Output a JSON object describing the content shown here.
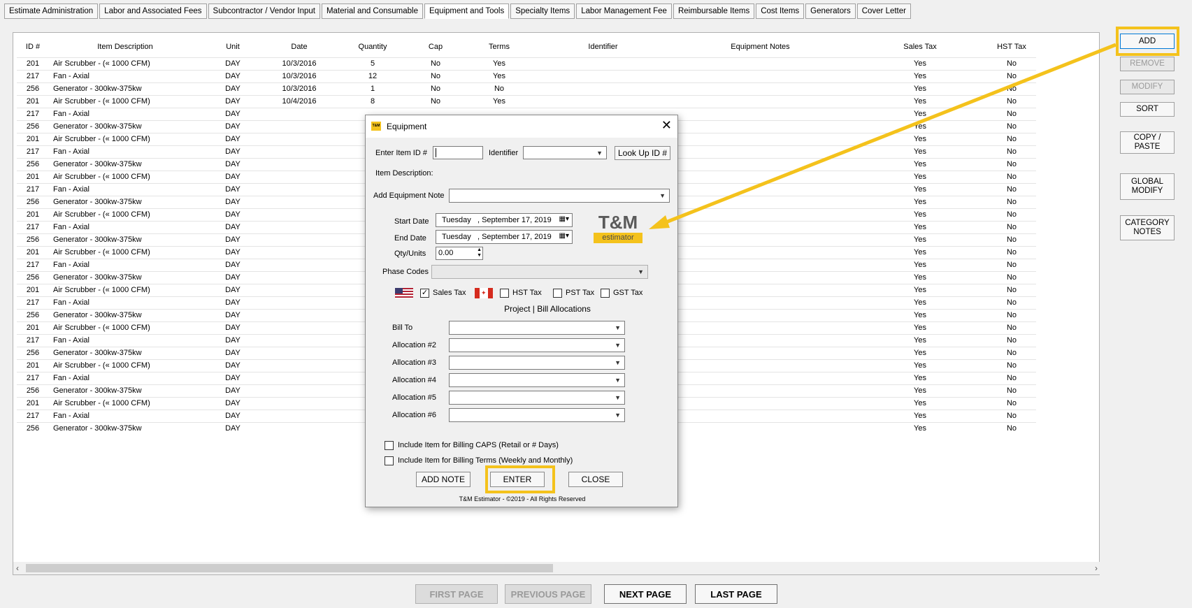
{
  "tabs": [
    "Estimate Administration",
    "Labor and Associated Fees",
    "Subcontractor / Vendor Input",
    "Material and Consumable",
    "Equipment and Tools",
    "Specialty Items",
    "Labor Management Fee",
    "Reimbursable Items",
    "Cost Items",
    "Generators",
    "Cover Letter"
  ],
  "active_tab": "Equipment and Tools",
  "table": {
    "headers": [
      "ID #",
      "Item Description",
      "Unit",
      "Date",
      "Quantity",
      "Cap",
      "Terms",
      "Identifier",
      "Equipment Notes",
      "Sales Tax",
      "HST Tax"
    ],
    "rows": [
      [
        "201",
        "Air Scrubber - (« 1000 CFM)",
        "DAY",
        "10/3/2016",
        "5",
        "No",
        "Yes",
        "",
        "",
        "Yes",
        "No"
      ],
      [
        "217",
        "Fan - Axial",
        "DAY",
        "10/3/2016",
        "12",
        "No",
        "Yes",
        "",
        "",
        "Yes",
        "No"
      ],
      [
        "256",
        "Generator - 300kw-375kw",
        "DAY",
        "10/3/2016",
        "1",
        "No",
        "No",
        "",
        "",
        "Yes",
        "No"
      ],
      [
        "201",
        "Air Scrubber - (« 1000 CFM)",
        "DAY",
        "10/4/2016",
        "8",
        "No",
        "Yes",
        "",
        "",
        "Yes",
        "No"
      ],
      [
        "217",
        "Fan - Axial",
        "DAY",
        "",
        "",
        "",
        "",
        "",
        "",
        "Yes",
        "No"
      ],
      [
        "256",
        "Generator - 300kw-375kw",
        "DAY",
        "",
        "",
        "",
        "",
        "",
        "",
        "Yes",
        "No"
      ],
      [
        "201",
        "Air Scrubber - (« 1000 CFM)",
        "DAY",
        "",
        "",
        "",
        "",
        "",
        "",
        "Yes",
        "No"
      ],
      [
        "217",
        "Fan - Axial",
        "DAY",
        "",
        "",
        "",
        "",
        "",
        "",
        "Yes",
        "No"
      ],
      [
        "256",
        "Generator - 300kw-375kw",
        "DAY",
        "",
        "",
        "",
        "",
        "",
        "",
        "Yes",
        "No"
      ],
      [
        "201",
        "Air Scrubber - (« 1000 CFM)",
        "DAY",
        "",
        "",
        "",
        "",
        "",
        "",
        "Yes",
        "No"
      ],
      [
        "217",
        "Fan - Axial",
        "DAY",
        "",
        "",
        "",
        "",
        "",
        "",
        "Yes",
        "No"
      ],
      [
        "256",
        "Generator - 300kw-375kw",
        "DAY",
        "",
        "",
        "",
        "",
        "",
        "",
        "Yes",
        "No"
      ],
      [
        "201",
        "Air Scrubber - (« 1000 CFM)",
        "DAY",
        "",
        "",
        "",
        "",
        "",
        "",
        "Yes",
        "No"
      ],
      [
        "217",
        "Fan - Axial",
        "DAY",
        "",
        "",
        "",
        "",
        "",
        "",
        "Yes",
        "No"
      ],
      [
        "256",
        "Generator - 300kw-375kw",
        "DAY",
        "",
        "",
        "",
        "",
        "",
        "",
        "Yes",
        "No"
      ],
      [
        "201",
        "Air Scrubber - (« 1000 CFM)",
        "DAY",
        "",
        "",
        "",
        "",
        "",
        "",
        "Yes",
        "No"
      ],
      [
        "217",
        "Fan - Axial",
        "DAY",
        "",
        "",
        "",
        "",
        "",
        "",
        "Yes",
        "No"
      ],
      [
        "256",
        "Generator - 300kw-375kw",
        "DAY",
        "",
        "",
        "",
        "",
        "",
        "",
        "Yes",
        "No"
      ],
      [
        "201",
        "Air Scrubber - (« 1000 CFM)",
        "DAY",
        "",
        "",
        "",
        "",
        "",
        "",
        "Yes",
        "No"
      ],
      [
        "217",
        "Fan - Axial",
        "DAY",
        "",
        "",
        "",
        "",
        "",
        "",
        "Yes",
        "No"
      ],
      [
        "256",
        "Generator - 300kw-375kw",
        "DAY",
        "",
        "",
        "",
        "",
        "",
        "",
        "Yes",
        "No"
      ],
      [
        "201",
        "Air Scrubber - (« 1000 CFM)",
        "DAY",
        "",
        "",
        "",
        "",
        "",
        "",
        "Yes",
        "No"
      ],
      [
        "217",
        "Fan - Axial",
        "DAY",
        "",
        "",
        "",
        "",
        "",
        "",
        "Yes",
        "No"
      ],
      [
        "256",
        "Generator - 300kw-375kw",
        "DAY",
        "",
        "",
        "",
        "",
        "",
        "",
        "Yes",
        "No"
      ],
      [
        "201",
        "Air Scrubber - (« 1000 CFM)",
        "DAY",
        "",
        "",
        "",
        "",
        "",
        "",
        "Yes",
        "No"
      ],
      [
        "217",
        "Fan - Axial",
        "DAY",
        "",
        "",
        "",
        "",
        "",
        "",
        "Yes",
        "No"
      ],
      [
        "256",
        "Generator - 300kw-375kw",
        "DAY",
        "",
        "",
        "",
        "",
        "",
        "",
        "Yes",
        "No"
      ],
      [
        "201",
        "Air Scrubber - (« 1000 CFM)",
        "DAY",
        "",
        "",
        "",
        "",
        "",
        "",
        "Yes",
        "No"
      ],
      [
        "217",
        "Fan - Axial",
        "DAY",
        "",
        "",
        "",
        "",
        "",
        "",
        "Yes",
        "No"
      ],
      [
        "256",
        "Generator - 300kw-375kw",
        "DAY",
        "",
        "",
        "",
        "",
        "",
        "",
        "Yes",
        "No"
      ]
    ]
  },
  "side_buttons": {
    "add": "ADD",
    "remove": "REMOVE",
    "modify": "MODIFY",
    "sort": "SORT",
    "copy_paste_1": "COPY /",
    "copy_paste_2": "PASTE",
    "global_modify_1": "GLOBAL",
    "global_modify_2": "MODIFY",
    "category_notes_1": "CATEGORY",
    "category_notes_2": "NOTES"
  },
  "pagination": {
    "first": "FIRST PAGE",
    "previous": "PREVIOUS PAGE",
    "next": "NEXT PAGE",
    "last": "LAST PAGE"
  },
  "dialog": {
    "title": "Equipment",
    "app_icon_text": "T&M",
    "enter_item_id_label": "Enter Item ID #",
    "enter_item_id_value": "",
    "identifier_label": "Identifier",
    "identifier_value": "",
    "look_up_button": "Look Up ID #",
    "item_description_label": "Item Description:",
    "add_note_label": "Add Equipment Note",
    "add_note_value": "",
    "start_date_label": "Start Date",
    "start_date_value": "Tuesday   , September 17, 2019",
    "end_date_label": "End Date",
    "end_date_value": "Tuesday   , September 17, 2019",
    "qty_label": "Qty/Units",
    "qty_value": "0.00",
    "phase_codes_label": "Phase Codes",
    "phase_codes_value": "",
    "logo_line1": "T&M",
    "logo_line2": "estimator",
    "sales_tax_label": "Sales Tax",
    "sales_tax_checked": true,
    "hst_tax_label": "HST Tax",
    "pst_tax_label": "PST Tax",
    "gst_tax_label": "GST Tax",
    "allocations_header": "Project | Bill Allocations",
    "allocations": [
      {
        "label": "Bill To",
        "value": ""
      },
      {
        "label": "Allocation #2",
        "value": ""
      },
      {
        "label": "Allocation #3",
        "value": ""
      },
      {
        "label": "Allocation #4",
        "value": ""
      },
      {
        "label": "Allocation #5",
        "value": ""
      },
      {
        "label": "Allocation #6",
        "value": ""
      }
    ],
    "include_caps_label": "Include Item for Billing CAPS (Retail or # Days)",
    "include_terms_label": "Include Item for Billing Terms (Weekly and Monthly)",
    "add_note_button": "ADD NOTE",
    "enter_button": "ENTER",
    "close_button": "CLOSE",
    "footer": "T&M Estimator - ©2019 - All Rights Reserved"
  },
  "colors": {
    "highlight": "#f4c21c",
    "logo_yellow": "#f4c21c",
    "logo_gray": "#5a5a5a"
  }
}
